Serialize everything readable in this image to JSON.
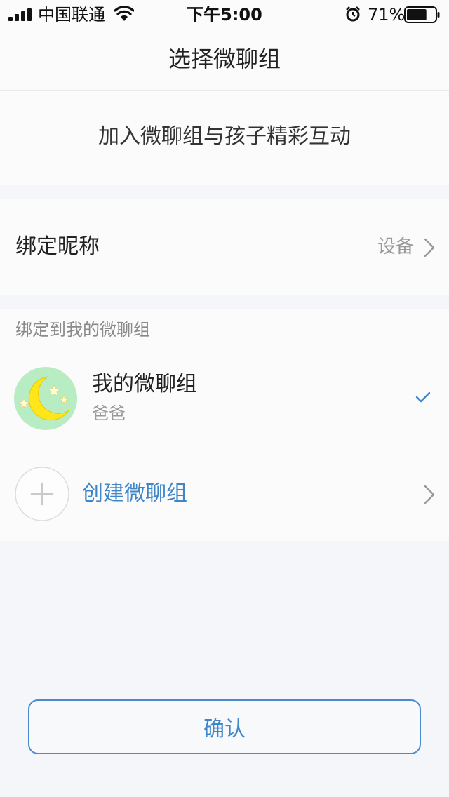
{
  "status_bar": {
    "carrier": "中国联通",
    "time": "下午5:00",
    "battery_percent": "71%",
    "battery_level": 0.71,
    "icons": [
      "signal-icon",
      "wifi-icon",
      "alarm-icon",
      "battery-icon"
    ]
  },
  "nav": {
    "title": "选择微聊组"
  },
  "banner": {
    "text": "加入微聊组与孩子精彩互动"
  },
  "nickname_row": {
    "label": "绑定昵称",
    "value": "设备"
  },
  "group_section": {
    "label": "绑定到我的微聊组",
    "group": {
      "name": "我的微聊组",
      "role": "爸爸",
      "selected": true
    },
    "create_label": "创建微聊组"
  },
  "confirm_button": {
    "label": "确认"
  },
  "colors": {
    "accent": "#3f86c9",
    "background": "#f4f6f9",
    "card": "#fbfbfb",
    "avatar_bg": "#b8ecc3",
    "moon": "#ffe61a"
  }
}
